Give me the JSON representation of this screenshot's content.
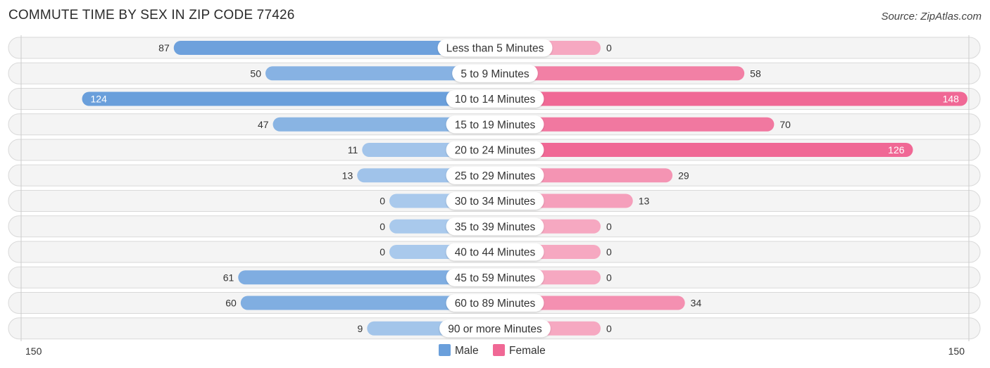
{
  "title": "COMMUTE TIME BY SEX IN ZIP CODE 77426",
  "source": "Source: ZipAtlas.com",
  "colors": {
    "male": "#6a9fdb",
    "male_light": "#a9c9ec",
    "female": "#f06895",
    "female_light": "#f6a8c1",
    "row_bg": "#f4f4f4"
  },
  "chart_data": {
    "type": "bar",
    "orientation": "horizontal-diverging",
    "title": "COMMUTE TIME BY SEX IN ZIP CODE 77426",
    "categories": [
      "Less than 5 Minutes",
      "5 to 9 Minutes",
      "10 to 14 Minutes",
      "15 to 19 Minutes",
      "20 to 24 Minutes",
      "25 to 29 Minutes",
      "30 to 34 Minutes",
      "35 to 39 Minutes",
      "40 to 44 Minutes",
      "45 to 59 Minutes",
      "60 to 89 Minutes",
      "90 or more Minutes"
    ],
    "series": [
      {
        "name": "Male",
        "values": [
          87,
          50,
          124,
          47,
          11,
          13,
          0,
          0,
          0,
          61,
          60,
          9
        ]
      },
      {
        "name": "Female",
        "values": [
          0,
          58,
          148,
          70,
          126,
          29,
          13,
          0,
          0,
          0,
          34,
          0
        ]
      }
    ],
    "axis": {
      "left_label": "150",
      "right_label": "150",
      "max": 150
    },
    "legend": {
      "position": "bottom-center",
      "items": [
        "Male",
        "Female"
      ]
    },
    "xlabel": "",
    "ylabel": ""
  }
}
